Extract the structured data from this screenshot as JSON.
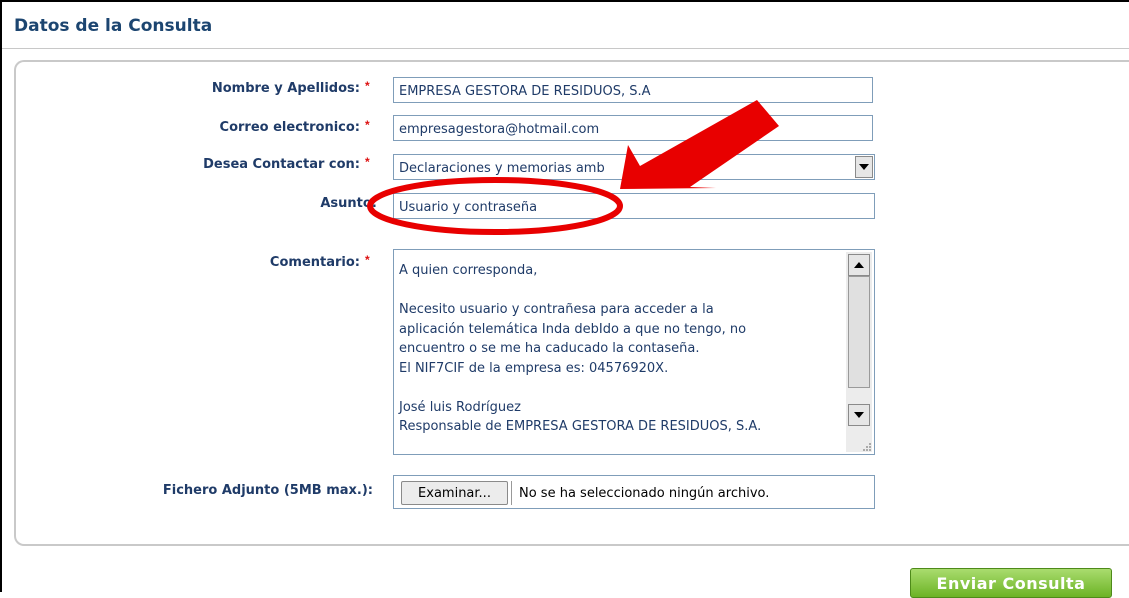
{
  "form": {
    "title": "Datos de la Consulta",
    "required_mark": "*",
    "fields": {
      "nombre": {
        "label": "Nombre y Apellidos:",
        "value": "EMPRESA GESTORA DE RESIDUOS, S.A"
      },
      "correo": {
        "label": "Correo electronico:",
        "value": "empresagestora@hotmail.com"
      },
      "contactar": {
        "label": "Desea Contactar con:",
        "value": "Declaraciones y memorias amb"
      },
      "asunto": {
        "label": "Asunto:",
        "value": "Usuario y contraseña"
      },
      "comentario": {
        "label": "Comentario:",
        "lines": [
          "A quien corresponda,",
          "",
          "Necesito usuario y contrañesa para acceder a la",
          "aplicación telemática Inda debIdo a que no tengo, no",
          "encuentro o se me ha caducado la contaseña.",
          "El NIF7CIF de la empresa es: 04576920X.",
          "",
          "José luis Rodríguez",
          "Responsable de EMPRESA GESTORA DE RESIDUOS, S.A."
        ]
      },
      "fichero": {
        "label": "Fichero Adjunto (5MB max.):",
        "button": "Examinar...",
        "status": "No se ha seleccionado ningún archivo."
      }
    },
    "submit_label": "Enviar Consulta"
  },
  "colors": {
    "label": "#1f3b68",
    "required": "#dd1111",
    "annotation": "#e80000",
    "submit": "#7cc232"
  }
}
